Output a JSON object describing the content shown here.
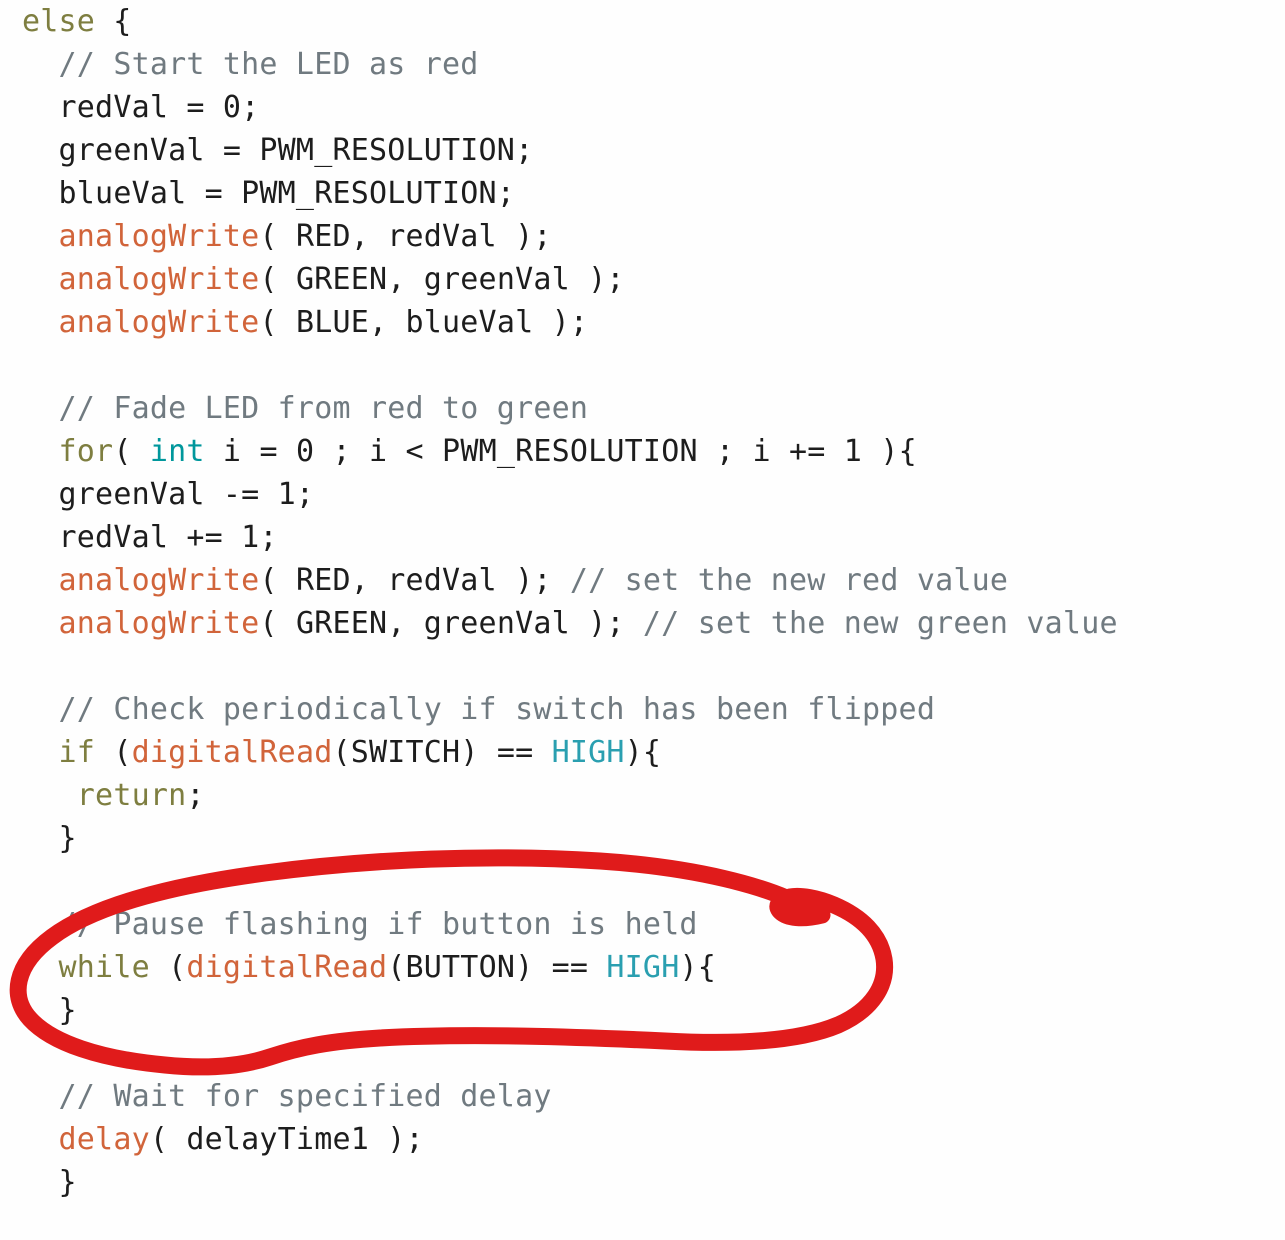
{
  "document": {
    "type": "source-code-screenshot",
    "language": "Arduino C++",
    "background_color": "#fefefe"
  },
  "theme": {
    "keyword_color": "#7e7e40",
    "function_color": "#d1643a",
    "type_color": "#00979c",
    "constant_color": "#2a9fb0",
    "comment_color": "#707a80",
    "plain_color": "#1d1d1d",
    "annotation_color": "#e01b1b"
  },
  "annotation": {
    "shape": "hand-drawn-ellipse",
    "color": "#e01b1b",
    "stroke_width": 17,
    "highlights_lines": [
      19,
      20,
      21
    ],
    "label": "red-circle-annotation"
  },
  "code": {
    "lines": [
      {
        "n": 1,
        "indent": 0,
        "tokens": [
          {
            "t": "kw",
            "v": "else"
          },
          {
            "t": "pl",
            "v": " {"
          }
        ]
      },
      {
        "n": 2,
        "indent": 1,
        "tokens": [
          {
            "t": "cm",
            "v": "// Start the LED as red"
          }
        ]
      },
      {
        "n": 3,
        "indent": 1,
        "tokens": [
          {
            "t": "pl",
            "v": "redVal = 0;"
          }
        ]
      },
      {
        "n": 4,
        "indent": 1,
        "tokens": [
          {
            "t": "pl",
            "v": "greenVal = PWM_RESOLUTION;"
          }
        ]
      },
      {
        "n": 5,
        "indent": 1,
        "tokens": [
          {
            "t": "pl",
            "v": "blueVal = PWM_RESOLUTION;"
          }
        ]
      },
      {
        "n": 6,
        "indent": 1,
        "tokens": [
          {
            "t": "fn",
            "v": "analogWrite"
          },
          {
            "t": "pl",
            "v": "( RED, redVal );"
          }
        ]
      },
      {
        "n": 7,
        "indent": 1,
        "tokens": [
          {
            "t": "fn",
            "v": "analogWrite"
          },
          {
            "t": "pl",
            "v": "( GREEN, greenVal );"
          }
        ]
      },
      {
        "n": 8,
        "indent": 1,
        "tokens": [
          {
            "t": "fn",
            "v": "analogWrite"
          },
          {
            "t": "pl",
            "v": "( BLUE, blueVal );"
          }
        ]
      },
      {
        "n": 9,
        "indent": 0,
        "tokens": []
      },
      {
        "n": 10,
        "indent": 1,
        "tokens": [
          {
            "t": "cm",
            "v": "// Fade LED from red to green"
          }
        ]
      },
      {
        "n": 11,
        "indent": 1,
        "tokens": [
          {
            "t": "kw",
            "v": "for"
          },
          {
            "t": "pl",
            "v": "( "
          },
          {
            "t": "type",
            "v": "int"
          },
          {
            "t": "pl",
            "v": " i = 0 ; i < PWM_RESOLUTION ; i += 1 ){"
          }
        ]
      },
      {
        "n": 12,
        "indent": 1,
        "tokens": [
          {
            "t": "pl",
            "v": "greenVal -= 1;"
          }
        ]
      },
      {
        "n": 13,
        "indent": 1,
        "tokens": [
          {
            "t": "pl",
            "v": "redVal += 1;"
          }
        ]
      },
      {
        "n": 14,
        "indent": 1,
        "tokens": [
          {
            "t": "fn",
            "v": "analogWrite"
          },
          {
            "t": "pl",
            "v": "( RED, redVal ); "
          },
          {
            "t": "cm",
            "v": "// set the new red value"
          }
        ]
      },
      {
        "n": 15,
        "indent": 1,
        "tokens": [
          {
            "t": "fn",
            "v": "analogWrite"
          },
          {
            "t": "pl",
            "v": "( GREEN, greenVal ); "
          },
          {
            "t": "cm",
            "v": "// set the new green value"
          }
        ]
      },
      {
        "n": 16,
        "indent": 0,
        "tokens": []
      },
      {
        "n": 17,
        "indent": 1,
        "tokens": [
          {
            "t": "cm",
            "v": "// Check periodically if switch has been flipped"
          }
        ]
      },
      {
        "n": 18,
        "indent": 1,
        "tokens": [
          {
            "t": "kw",
            "v": "if"
          },
          {
            "t": "pl",
            "v": " ("
          },
          {
            "t": "fn",
            "v": "digitalRead"
          },
          {
            "t": "pl",
            "v": "(SWITCH) == "
          },
          {
            "t": "cst",
            "v": "HIGH"
          },
          {
            "t": "pl",
            "v": "){"
          }
        ]
      },
      {
        "n": 19,
        "indent": 1,
        "tokens": [
          {
            "t": "pl",
            "v": " "
          },
          {
            "t": "kw",
            "v": "return"
          },
          {
            "t": "pl",
            "v": ";"
          }
        ]
      },
      {
        "n": 20,
        "indent": 1,
        "tokens": [
          {
            "t": "pl",
            "v": "}"
          }
        ]
      },
      {
        "n": 21,
        "indent": 0,
        "tokens": []
      },
      {
        "n": 22,
        "indent": 1,
        "tokens": [
          {
            "t": "cm",
            "v": "// Pause flashing if button is held"
          }
        ]
      },
      {
        "n": 23,
        "indent": 1,
        "tokens": [
          {
            "t": "kw",
            "v": "while"
          },
          {
            "t": "pl",
            "v": " ("
          },
          {
            "t": "fn",
            "v": "digitalRead"
          },
          {
            "t": "pl",
            "v": "(BUTTON) == "
          },
          {
            "t": "cst",
            "v": "HIGH"
          },
          {
            "t": "pl",
            "v": "){"
          }
        ]
      },
      {
        "n": 24,
        "indent": 1,
        "tokens": [
          {
            "t": "pl",
            "v": "}"
          }
        ]
      },
      {
        "n": 25,
        "indent": 0,
        "tokens": []
      },
      {
        "n": 26,
        "indent": 1,
        "tokens": [
          {
            "t": "cm",
            "v": "// Wait for specified delay"
          }
        ]
      },
      {
        "n": 27,
        "indent": 1,
        "tokens": [
          {
            "t": "fn",
            "v": "delay"
          },
          {
            "t": "pl",
            "v": "( delayTime1 );"
          }
        ]
      },
      {
        "n": 28,
        "indent": 1,
        "tokens": [
          {
            "t": "pl",
            "v": "}"
          }
        ]
      }
    ]
  }
}
